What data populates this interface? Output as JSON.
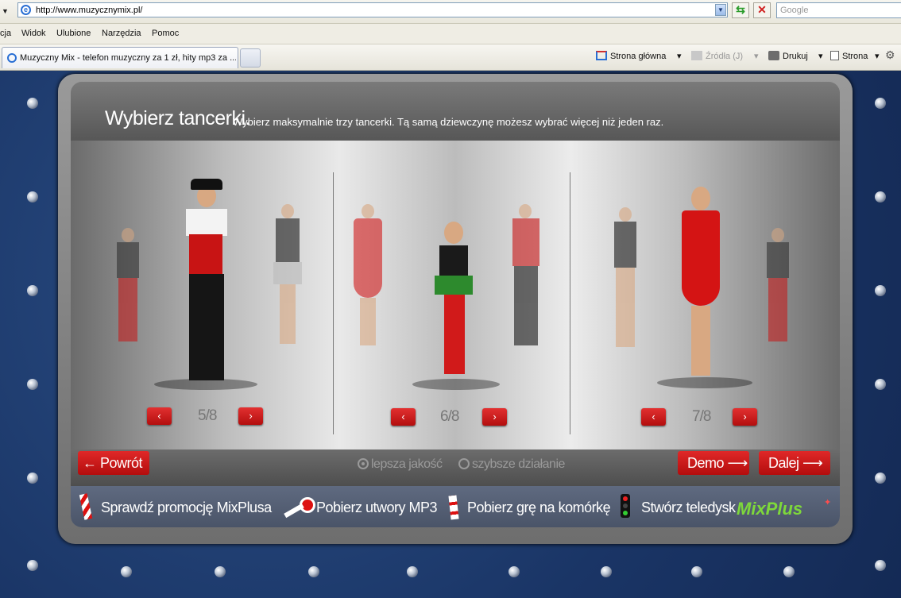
{
  "browser": {
    "url": "http://www.muzycznymix.pl/",
    "search_placeholder": "Google",
    "menu": [
      "cja",
      "Widok",
      "Ulubione",
      "Narzędzia",
      "Pomoc"
    ],
    "tab_title": "Muzyczny Mix - telefon muzyczny za 1 zł, hity mp3 za ...",
    "commands": {
      "home": "Strona główna",
      "feeds": "Źródła (J)",
      "print": "Drukuj",
      "page": "Strona"
    }
  },
  "header": {
    "title": "Wybierz tancerki.",
    "subtitle": "Wybierz maksymalnie trzy tancerki. Tą samą dziewczynę możesz wybrać więcej niż jeden raz."
  },
  "selectors": [
    {
      "counter": "5/8",
      "prev": "‹",
      "next": "›"
    },
    {
      "counter": "6/8",
      "prev": "‹",
      "next": "›"
    },
    {
      "counter": "7/8",
      "prev": "‹",
      "next": "›"
    }
  ],
  "controls": {
    "back": "← Powrót",
    "quality_better": "lepsza jakość",
    "quality_faster": "szybsze działanie",
    "demo": "Demo",
    "next": "Dalej"
  },
  "promo": {
    "check_promo": "Sprawdź promocję MixPlusa",
    "download_mp3": "Pobierz utwory MP3",
    "download_game": "Pobierz grę na komórkę",
    "create_video": "Stwórz teledysk",
    "logo": "MixPlus"
  },
  "colors": {
    "accent_red": "#c81414",
    "logo_green": "#7ed83b"
  }
}
